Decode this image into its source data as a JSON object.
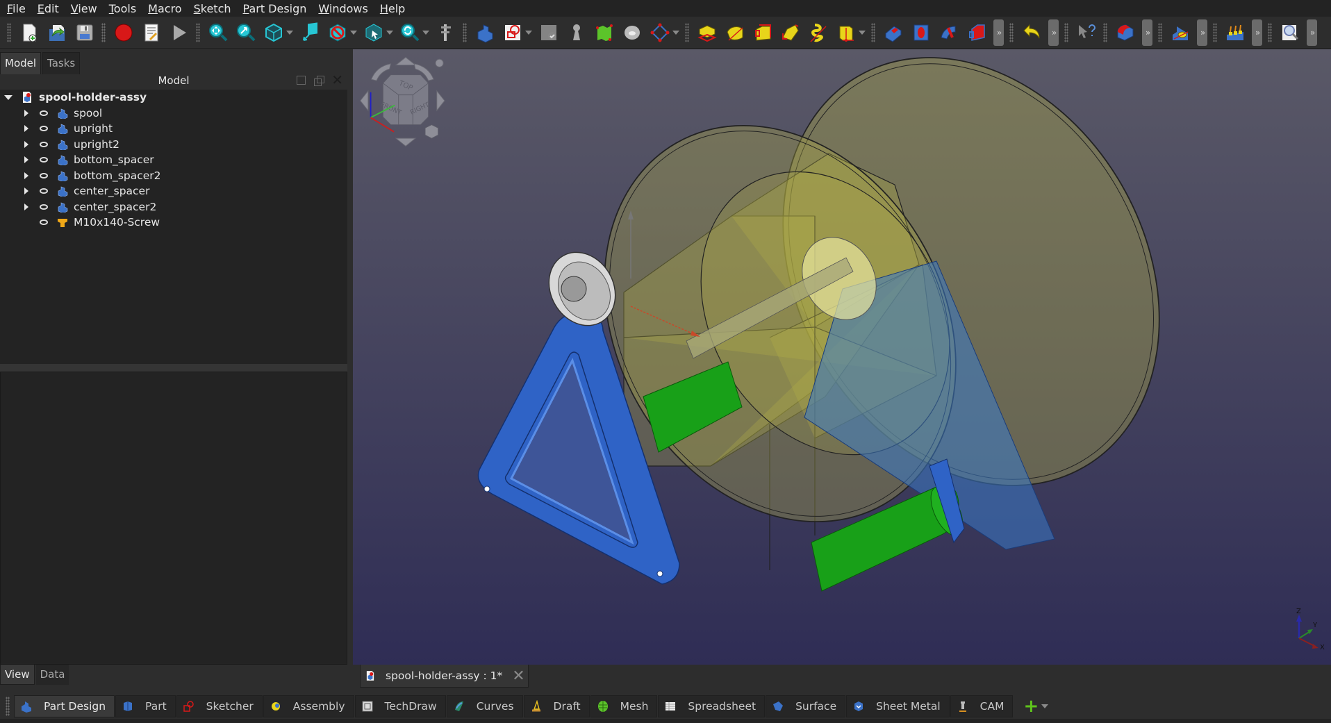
{
  "menu": [
    {
      "label": "File",
      "accel": "F"
    },
    {
      "label": "Edit",
      "accel": "E"
    },
    {
      "label": "View",
      "accel": "V"
    },
    {
      "label": "Tools",
      "accel": "T"
    },
    {
      "label": "Macro",
      "accel": "M"
    },
    {
      "label": "Sketch",
      "accel": "S"
    },
    {
      "label": "Part Design",
      "accel": "P"
    },
    {
      "label": "Windows",
      "accel": "W"
    },
    {
      "label": "Help",
      "accel": "H"
    }
  ],
  "toolbar": {
    "file": [
      "new-document-icon",
      "open-document-icon",
      "save-document-icon"
    ],
    "macro": [
      "macro-record-icon",
      "macro-edit-icon",
      "macro-run-icon"
    ],
    "view": [
      "fit-all-icon",
      "fit-selection-icon",
      "isometric-view-icon",
      "bounding-box-icon",
      "draw-style-icon",
      "selection-filter-icon",
      "sync-view-icon",
      "measure-icon"
    ],
    "partdesign_helpers": [
      "create-body-icon",
      "create-sketch-icon",
      "validate-sketch-icon",
      "clone-icon",
      "shape-binder-icon",
      "sub-shape-binder-icon",
      "datum-plane-icon"
    ],
    "partdesign_additive": [
      "pad-icon",
      "revolution-icon",
      "additive-loft-icon",
      "additive-pipe-icon",
      "additive-helix-icon",
      "additive-primitive-icon"
    ],
    "partdesign_subtractive": [
      "pocket-icon",
      "hole-icon",
      "groove-icon",
      "subtractive-loft-icon"
    ],
    "edit": [
      "undo-icon"
    ],
    "help": [
      "whats-this-icon"
    ],
    "dress": [
      "fillet-icon"
    ],
    "boolean": [
      "boolean-icon"
    ],
    "pattern": [
      "multi-transform-icon"
    ],
    "inspect": [
      "inspection-icon"
    ]
  },
  "combo": {
    "tabs": [
      "Model",
      "Tasks"
    ],
    "active_tab": "Model",
    "tree_title": "Model",
    "tree": {
      "root": {
        "label": "spool-holder-assy",
        "icon": "document-icon",
        "expanded": true
      },
      "items": [
        {
          "label": "spool",
          "icon": "body-icon",
          "expandable": true,
          "visible": true
        },
        {
          "label": "upright",
          "icon": "body-icon",
          "expandable": true,
          "visible": true
        },
        {
          "label": "upright2",
          "icon": "body-icon",
          "expandable": true,
          "visible": true
        },
        {
          "label": "bottom_spacer",
          "icon": "body-icon",
          "expandable": true,
          "visible": true
        },
        {
          "label": "bottom_spacer2",
          "icon": "body-icon",
          "expandable": true,
          "visible": true
        },
        {
          "label": "center_spacer",
          "icon": "body-icon",
          "expandable": true,
          "visible": true
        },
        {
          "label": "center_spacer2",
          "icon": "body-icon",
          "expandable": true,
          "visible": true
        },
        {
          "label": "M10x140-Screw",
          "icon": "screw-icon",
          "expandable": false,
          "visible": true
        }
      ]
    },
    "property_tabs": [
      "View",
      "Data"
    ],
    "active_property_tab": "View"
  },
  "viewport": {
    "navcube_faces": [
      "TOP",
      "FRONT",
      "RIGHT"
    ],
    "axis_labels": [
      "Z",
      "Y",
      "X"
    ],
    "colors": {
      "bg_top": "#5a5967",
      "bg_bottom": "#2f2d55",
      "upright": "#2f63c6",
      "spacer": "#18a018",
      "spool": "#b7b546",
      "screw_head": "#cfcfcf"
    }
  },
  "document_tab": {
    "label": "spool-holder-assy : 1*"
  },
  "workbenches": [
    {
      "label": "Part Design",
      "active": true
    },
    {
      "label": "Part"
    },
    {
      "label": "Sketcher"
    },
    {
      "label": "Assembly"
    },
    {
      "label": "TechDraw"
    },
    {
      "label": "Curves"
    },
    {
      "label": "Draft"
    },
    {
      "label": "Mesh"
    },
    {
      "label": "Spreadsheet"
    },
    {
      "label": "Surface"
    },
    {
      "label": "Sheet Metal"
    },
    {
      "label": "CAM"
    }
  ]
}
